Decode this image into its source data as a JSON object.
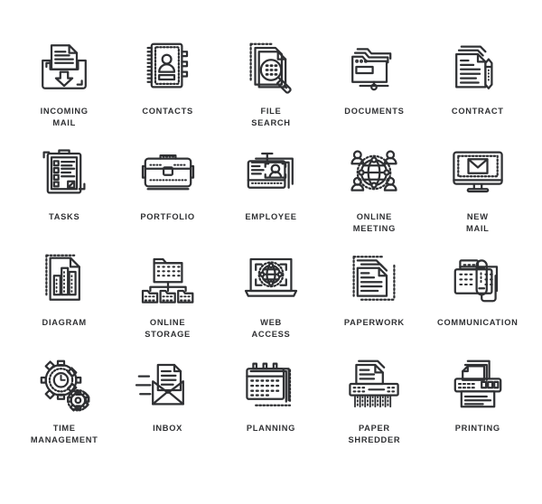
{
  "page": {
    "background_color": "#ffffff",
    "stroke_color": "#2f3033",
    "columns": 5,
    "rows": 4,
    "total_icons": 20
  },
  "icons": [
    {
      "id": "incoming-mail",
      "label": "INCOMING\nMAIL",
      "glyph": "tray-with-document-and-down-arrow",
      "row": 1,
      "col": 1
    },
    {
      "id": "contacts",
      "label": "CONTACTS",
      "glyph": "address-book-with-person",
      "row": 1,
      "col": 2
    },
    {
      "id": "file-search",
      "label": "FILE\nSEARCH",
      "glyph": "documents-with-magnifier",
      "row": 1,
      "col": 3
    },
    {
      "id": "documents",
      "label": "DOCUMENTS",
      "glyph": "folder-stack-network",
      "row": 1,
      "col": 4
    },
    {
      "id": "contract",
      "label": "CONTRACT",
      "glyph": "document-stack-with-pen",
      "row": 1,
      "col": 5
    },
    {
      "id": "tasks",
      "label": "TASKS",
      "glyph": "clipboard-checklist",
      "row": 2,
      "col": 1
    },
    {
      "id": "portfolio",
      "label": "PORTFOLIO",
      "glyph": "briefcase",
      "row": 2,
      "col": 2
    },
    {
      "id": "employee",
      "label": "EMPLOYEE",
      "glyph": "id-badge-card",
      "row": 2,
      "col": 3
    },
    {
      "id": "online-meeting",
      "label": "ONLINE\nMEETING",
      "glyph": "globe-with-four-people",
      "row": 2,
      "col": 4
    },
    {
      "id": "new-mail",
      "label": "NEW\nMAIL",
      "glyph": "monitor-with-envelope",
      "row": 2,
      "col": 5
    },
    {
      "id": "diagram",
      "label": "DIAGRAM",
      "glyph": "document-with-bar-chart",
      "row": 3,
      "col": 1
    },
    {
      "id": "online-storage",
      "label": "ONLINE\nSTORAGE",
      "glyph": "folder-tree-servers",
      "row": 3,
      "col": 2
    },
    {
      "id": "web-access",
      "label": "WEB\nACCESS",
      "glyph": "laptop-with-globe",
      "row": 3,
      "col": 3
    },
    {
      "id": "paperwork",
      "label": "PAPERWORK",
      "glyph": "stacked-text-documents",
      "row": 3,
      "col": 4
    },
    {
      "id": "communication",
      "label": "COMMUNICATION",
      "glyph": "desk-telephone",
      "row": 3,
      "col": 5
    },
    {
      "id": "time-management",
      "label": "TIME\nMANAGEMENT",
      "glyph": "clock-with-gears",
      "row": 4,
      "col": 1
    },
    {
      "id": "inbox",
      "label": "INBOX",
      "glyph": "open-envelope-with-letter",
      "row": 4,
      "col": 2
    },
    {
      "id": "planning",
      "label": "PLANNING",
      "glyph": "calendar-stack",
      "row": 4,
      "col": 3
    },
    {
      "id": "paper-shredder",
      "label": "PAPER\nSHREDDER",
      "glyph": "shredder-with-document",
      "row": 4,
      "col": 4
    },
    {
      "id": "printing",
      "label": "PRINTING",
      "glyph": "printer-with-page",
      "row": 4,
      "col": 5
    }
  ]
}
